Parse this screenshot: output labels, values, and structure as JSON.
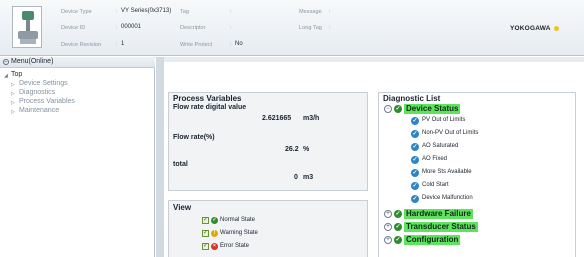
{
  "header": {
    "device_type_label": "Device Type",
    "device_type_value": "VY Series(0x3713)",
    "device_id_label": "Device ID",
    "device_id_value": "000001",
    "device_revision_label": "Device Revision",
    "device_revision_value": "1",
    "tag_label": "Tag",
    "descriptor_label": "Descriptor",
    "write_protect_label": "Write Protect",
    "write_protect_value": "No",
    "message_label": "Message",
    "long_tag_label": "Long Tag",
    "separator": ":",
    "brand": "YOKOGAWA",
    "brand_dot_color": "#f4c21a"
  },
  "menu": {
    "title": "Menu(Online)",
    "collapse_icon": "minus-circle-icon",
    "root": "Top",
    "items": [
      {
        "label": "Device Settings"
      },
      {
        "label": "Diagnostics"
      },
      {
        "label": "Process Variables"
      },
      {
        "label": "Maintenance"
      }
    ]
  },
  "process_variables": {
    "title": "Process Variables",
    "fields": [
      {
        "label": "Flow rate digital value",
        "value": "2.621665",
        "unit": "m3/h"
      },
      {
        "label": "Flow rate(%)",
        "value": "26.2",
        "unit": "%"
      },
      {
        "label": "total",
        "value": "0",
        "unit": "m3"
      }
    ]
  },
  "view": {
    "title": "View",
    "items": [
      {
        "label": "Normal State",
        "checked": true,
        "icon": "green-check-icon",
        "color": "#2f8b2f"
      },
      {
        "label": "Warning State",
        "checked": true,
        "icon": "warning-icon",
        "color": "#e0a800"
      },
      {
        "label": "Error State",
        "checked": true,
        "icon": "error-icon",
        "color": "#d9302c"
      }
    ]
  },
  "diagnostic_list": {
    "title": "Diagnostic List",
    "highlight_color": "#5fe35f",
    "categories": [
      {
        "label": "Device Status",
        "expanded": true,
        "items": [
          "PV Out of Limits",
          "Non-PV Out of Limits",
          "AO Saturated",
          "AO Fixed",
          "More Sts Available",
          "Cold Start",
          "Device Malfunction"
        ]
      },
      {
        "label": "Hardware Failure",
        "expanded": false
      },
      {
        "label": "Transducer Status",
        "expanded": false
      },
      {
        "label": "Configuration",
        "expanded": false
      }
    ]
  }
}
